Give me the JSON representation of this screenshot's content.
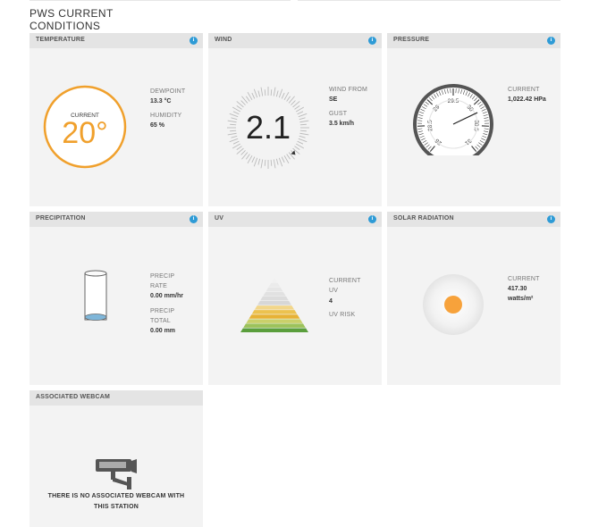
{
  "page_title": "PWS CURRENT CONDITIONS",
  "info_glyph": "i",
  "temperature": {
    "title": "TEMPERATURE",
    "current_label": "CURRENT",
    "current_value": "20°",
    "dewpoint_label": "DEWPOINT",
    "dewpoint_value": "13.3 °C",
    "humidity_label": "HUMIDITY",
    "humidity_value": "65 %",
    "ring_color": "#f0a02c"
  },
  "wind": {
    "title": "WIND",
    "speed": "2.1",
    "from_label": "WIND FROM",
    "from_value": "SE",
    "gust_label": "GUST",
    "gust_value": "3.5 km/h"
  },
  "pressure": {
    "title": "PRESSURE",
    "current_label": "CURRENT",
    "current_value": "1,022.42 HPa",
    "tick_labels": [
      "28",
      "28.5",
      "29",
      "29.5",
      "30",
      "30.5",
      "31"
    ]
  },
  "precipitation": {
    "title": "PRECIPITATION",
    "rate_label_1": "PRECIP",
    "rate_label_2": "RATE",
    "rate_value": "0.00 mm/hr",
    "total_label_1": "PRECIP",
    "total_label_2": "TOTAL",
    "total_value": "0.00 mm"
  },
  "uv": {
    "title": "UV",
    "current_label_1": "CURRENT",
    "current_label_2": "UV",
    "current_value": "4",
    "risk_label": "UV RISK"
  },
  "solar": {
    "title": "SOLAR RADIATION",
    "current_label": "CURRENT",
    "current_value": "417.30",
    "unit": "watts/m²",
    "sun_color": "#f7a23b"
  },
  "webcam": {
    "title": "ASSOCIATED WEBCAM",
    "message_line1": "THERE IS NO ASSOCIATED WEBCAM WITH",
    "message_line2": "THIS STATION"
  }
}
